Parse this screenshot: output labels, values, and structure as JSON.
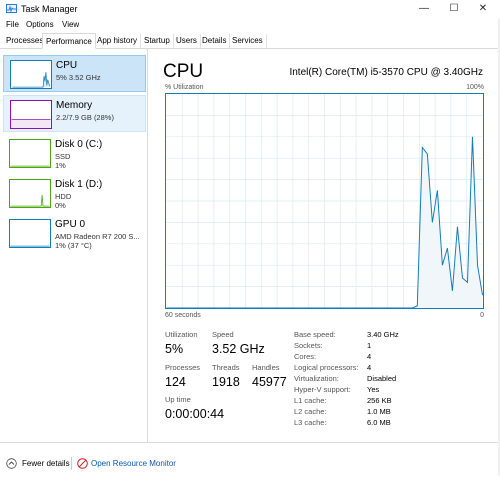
{
  "window": {
    "title": "Task Manager",
    "minimize": "—",
    "maximize": "☐",
    "close": "✕"
  },
  "menu": [
    "File",
    "Options",
    "View"
  ],
  "tabs": [
    "Processes",
    "Performance",
    "App history",
    "Startup",
    "Users",
    "Details",
    "Services"
  ],
  "active_tab": "Performance",
  "sidebar": [
    {
      "name": "CPU",
      "sub1": "5% 3.52 GHz",
      "sub2": "",
      "color": "#117dbb"
    },
    {
      "name": "Memory",
      "sub1": "2.2/7.9 GB (28%)",
      "sub2": "",
      "color": "#8b12ae"
    },
    {
      "name": "Disk 0 (C:)",
      "sub1": "SSD",
      "sub2": "1%",
      "color": "#4da60c"
    },
    {
      "name": "Disk 1 (D:)",
      "sub1": "HDD",
      "sub2": "0%",
      "color": "#4da60c"
    },
    {
      "name": "GPU 0",
      "sub1": "AMD Radeon R7 200 S...",
      "sub2": "1% (37 °C)",
      "color": "#117dbb"
    }
  ],
  "main": {
    "title": "CPU",
    "cpu_name": "Intel(R) Core(TM) i5-3570 CPU @ 3.40GHz",
    "graph_label": "% Utilization",
    "graph_max": "100%",
    "graph_time": "60 seconds",
    "graph_min": "0",
    "stats": {
      "utilization_label": "Utilization",
      "utilization": "5%",
      "speed_label": "Speed",
      "speed": "3.52 GHz",
      "processes_label": "Processes",
      "processes": "124",
      "threads_label": "Threads",
      "threads": "1918",
      "handles_label": "Handles",
      "handles": "45977",
      "uptime_label": "Up time",
      "uptime": "0:00:00:44"
    },
    "details": [
      {
        "label": "Base speed:",
        "value": "3.40 GHz"
      },
      {
        "label": "Sockets:",
        "value": "1"
      },
      {
        "label": "Cores:",
        "value": "4"
      },
      {
        "label": "Logical processors:",
        "value": "4"
      },
      {
        "label": "Virtualization:",
        "value": "Disabled"
      },
      {
        "label": "Hyper-V support:",
        "value": "Yes"
      },
      {
        "label": "L1 cache:",
        "value": "256 KB"
      },
      {
        "label": "L2 cache:",
        "value": "1.0 MB"
      },
      {
        "label": "L3 cache:",
        "value": "6.0 MB"
      }
    ],
    "cpu_history": [
      0,
      0,
      0,
      0,
      0,
      0,
      0,
      0,
      0,
      0,
      0,
      0,
      0,
      0,
      0,
      0,
      0,
      0,
      0,
      0,
      0,
      0,
      0,
      0,
      0,
      0,
      0,
      0,
      0,
      0,
      0,
      0,
      0,
      0,
      0,
      0,
      0,
      0,
      0,
      0,
      0,
      0,
      0,
      0,
      0,
      0,
      0,
      0,
      0,
      0,
      1,
      75,
      72,
      40,
      55,
      20,
      28,
      8,
      38,
      14,
      12,
      80,
      20,
      6
    ]
  },
  "footer": {
    "fewer_details": "Fewer details",
    "open_monitor": "Open Resource Monitor"
  },
  "colors": {
    "cpu": "#117dbb",
    "memory": "#8b12ae",
    "disk": "#4da60c",
    "grid": "#d9eaf5",
    "fill": "#f1f6fa"
  }
}
